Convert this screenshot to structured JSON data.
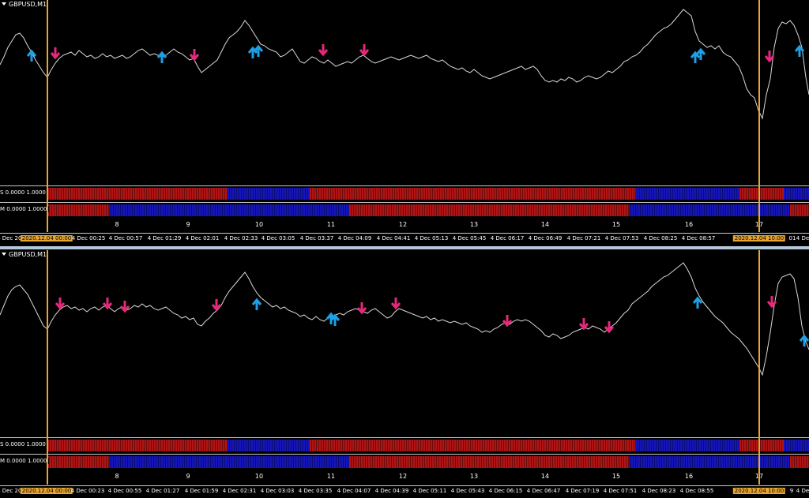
{
  "window_top": {
    "symbol": "GBPUSD,M1",
    "indicator1_label": "S 0.0000 1.0000",
    "indicator2_label": "M 0.0000 1.0000",
    "time_labels": [
      "4 Dec 202",
      "2020.12.04 00:00",
      "4 Dec 00:25",
      "4 Dec 00:57",
      "4 Dec 01:29",
      "4 Dec 02:01",
      "4 Dec 02:33",
      "4 Dec 03:05",
      "4 Dec 03:37",
      "4 Dec 04:09",
      "4 Dec 04:41",
      "4 Dec 05:13",
      "4 Dec 05:45",
      "4 Dec 06:17",
      "4 Dec 06:49",
      "4 Dec 07:21",
      "4 Dec 07:53",
      "4 Dec 08:25",
      "4 Dec 08:57",
      "2020.12.04 10:00",
      "01",
      "4 De"
    ]
  },
  "window_bottom": {
    "symbol": "GBPUSD,M1",
    "indicator1_label": "S 0.0000 1.0000",
    "indicator2_label": "M 0.0000 1.0000",
    "time_labels": [
      "4 Dec 202",
      "2020.12.04 00:00",
      "4 Dec 00:23",
      "4 Dec 00:55",
      "4 Dec 01:27",
      "4 Dec 01:59",
      "4 Dec 02:31",
      "4 Dec 03:03",
      "4 Dec 03:35",
      "4 Dec 04:07",
      "4 Dec 04:39",
      "4 Dec 05:11",
      "4 Dec 05:43",
      "4 Dec 06:15",
      "4 Dec 06:47",
      "4 Dec 07:19",
      "4 Dec 07:51",
      "4 Dec 08:23",
      "4 Dec 08:55",
      "2020.12.04 10:00",
      "9",
      "4 De"
    ]
  },
  "day_numbers": [
    "8",
    "9",
    "10",
    "11",
    "12",
    "13",
    "14",
    "15",
    "16",
    "17"
  ],
  "colors": {
    "background": "#000000",
    "price_line": "#d8d8d8",
    "up_arrow": "#1ea0e6",
    "down_arrow": "#e6287a",
    "indicator_red": "#b01515",
    "indicator_blue": "#1616b8",
    "period_marker": "#e8a530"
  },
  "icons": [
    "up-arrow-icon",
    "down-arrow-icon",
    "dropdown-triangle-icon"
  ]
}
